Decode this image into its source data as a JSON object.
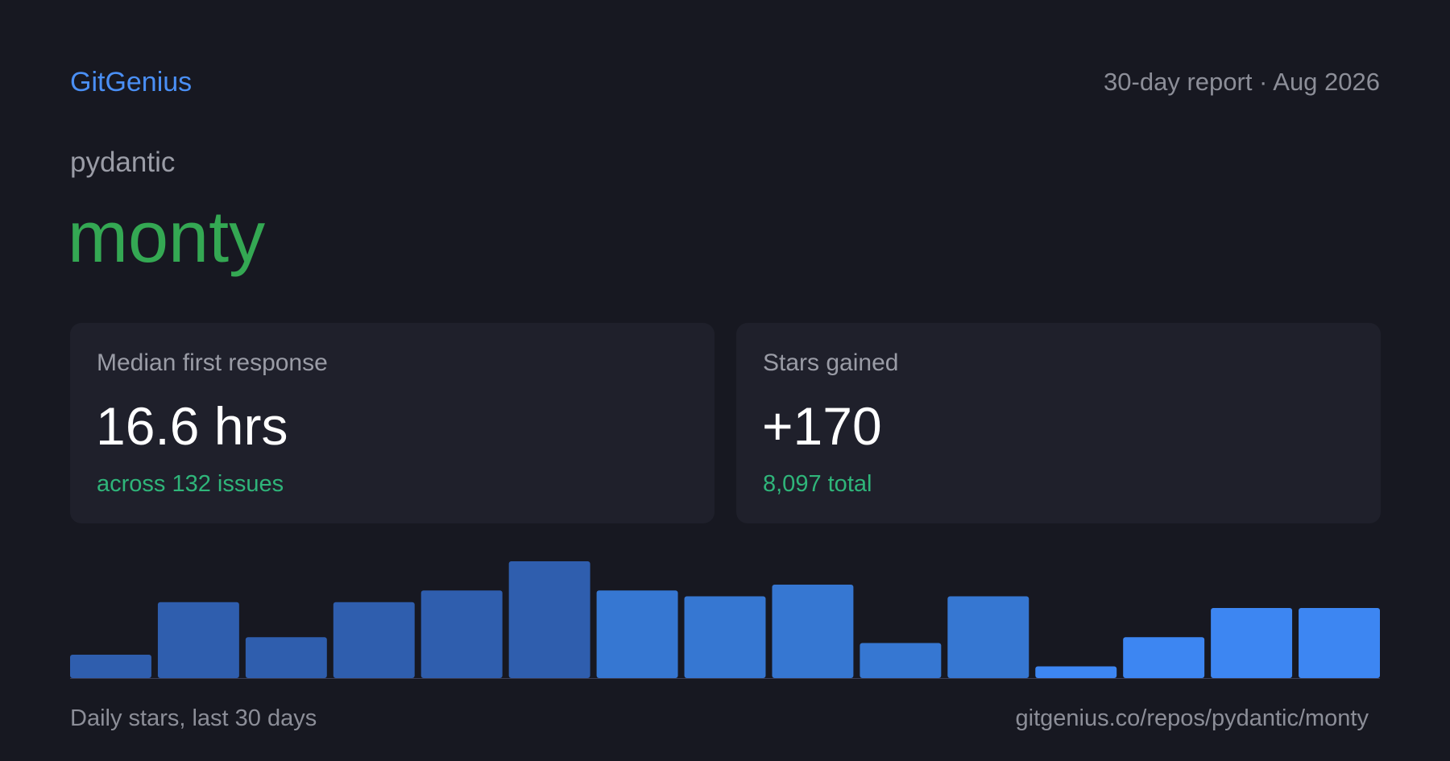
{
  "header": {
    "brand": "GitGenius",
    "report_meta": "30-day report · Aug 2026"
  },
  "repo": {
    "owner": "pydantic",
    "name": "monty"
  },
  "cards": [
    {
      "label": "Median first response",
      "value": "16.6 hrs",
      "sub": "across 132 issues"
    },
    {
      "label": "Stars gained",
      "value": "+170",
      "sub": "8,097 total"
    }
  ],
  "chart_data": {
    "type": "bar",
    "values": [
      2,
      6.5,
      3.5,
      6.5,
      7.5,
      10,
      7.5,
      7,
      8,
      3,
      7,
      1,
      3.5,
      6,
      6
    ],
    "colors": [
      "#2f5eae",
      "#2f5eae",
      "#2f5eae",
      "#2f5eae",
      "#2f5eae",
      "#2f5eae",
      "#3677d2",
      "#3677d2",
      "#3677d2",
      "#3677d2",
      "#3677d2",
      "#3d86f2",
      "#3d86f2",
      "#3d86f2",
      "#3d86f2"
    ],
    "title": "",
    "xlabel": "",
    "ylabel": "",
    "grid": false
  },
  "footer": {
    "caption": "Daily stars, last 30 days",
    "url": "gitgenius.co/repos/pydantic/monty"
  }
}
